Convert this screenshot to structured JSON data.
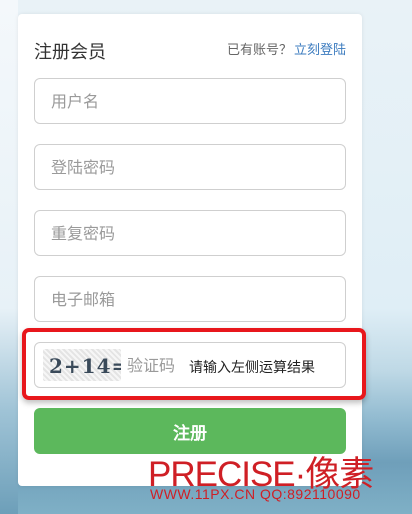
{
  "header": {
    "title": "注册会员",
    "login_prompt": "已有账号？",
    "login_link": "立刻登陆"
  },
  "form": {
    "username_placeholder": "用户名",
    "password_placeholder": "登陆密码",
    "confirm_password_placeholder": "重复密码",
    "email_placeholder": "电子邮箱",
    "captcha": {
      "image_text": "2+14=",
      "placeholder": "验证码",
      "hint": "请输入左侧运算结果"
    },
    "submit_label": "注册"
  },
  "watermark": {
    "logo": "PRECISE·像素",
    "contact": "WWW.11PX.CN QQ:892110090"
  },
  "colors": {
    "accent_green": "#5cb85c",
    "link_blue": "#3b7bbf",
    "highlight_red": "#e8171c",
    "watermark_red": "#cf1f25"
  }
}
